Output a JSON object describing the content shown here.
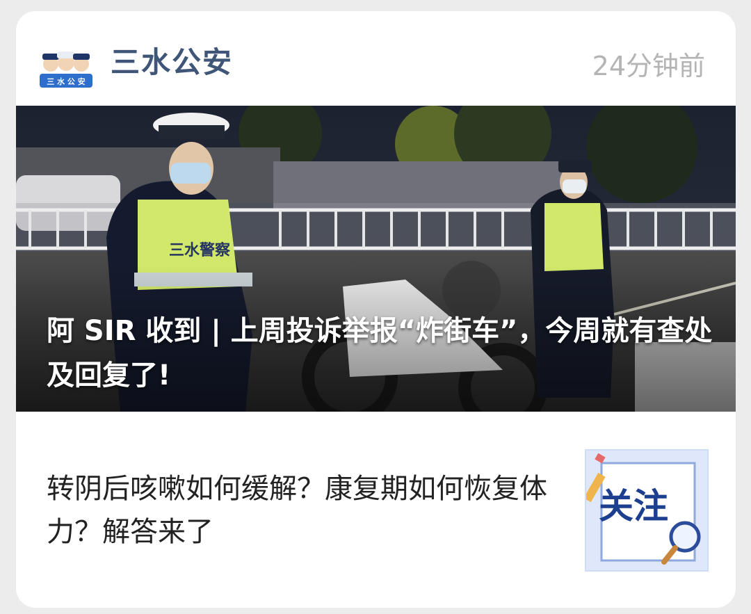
{
  "header": {
    "account_name": "三水公安",
    "timestamp": "24分钟前",
    "avatar_text": "三 水 公 安",
    "avatar_icon": "police-mascot-icon"
  },
  "articles": [
    {
      "title": "阿 SIR 收到 | 上周投诉举报“炸街车”，今周就有查处及回复了!",
      "badge_text": "三水警察",
      "image_desc_icon": "photo-police-motorcycle"
    },
    {
      "title": "转阴后咳嗽如何缓解？康复期如何恢复体力？解答来了",
      "thumbnail_text": "关注",
      "thumbnail_icons": [
        "pencil-icon",
        "magnifier-icon"
      ]
    }
  ],
  "colors": {
    "account_name": "#3f5678",
    "timestamp": "#b4b4b4",
    "thumbnail_text": "#1d3f8f"
  }
}
